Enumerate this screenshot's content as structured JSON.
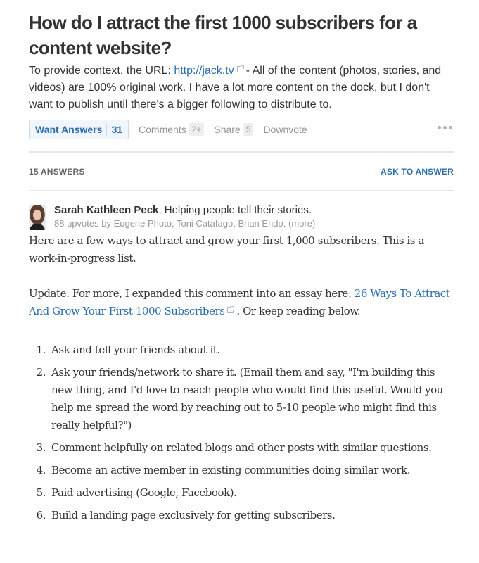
{
  "question": {
    "title": "How do I attract the first 1000 subscribers for a content website?",
    "details_before_link": "To provide context, the URL: ",
    "details_link": "http://jack.tv",
    "details_after_link": "- All of the content (photos, stories, and videos) are 100% original work. I have a lot more content on the dock, but I don't want to publish until there's a bigger following to distribute to."
  },
  "actions": {
    "want_answers_label": "Want Answers",
    "want_answers_count": "31",
    "comments_label": "Comments",
    "comments_count": "2+",
    "share_label": "Share",
    "share_count": "5",
    "downvote_label": "Downvote",
    "more_icon": "more-horizontal-icon"
  },
  "answers_header": {
    "count_label": "15 ANSWERS",
    "ask_to_answer_label": "ASK TO ANSWER"
  },
  "answer": {
    "author_name": "Sarah Kathleen Peck",
    "author_bio": ", Helping people tell their stories.",
    "upvotes_prefix": "88 upvotes by ",
    "voters": [
      "Eugene Photo",
      "Toni Catafago",
      "Brian Endo"
    ],
    "more_label": "(more)",
    "intro": "Here are a few ways to attract and grow your first 1,000 subscribers. This is a work-in-progress list.",
    "update_before_link": "Update: For more, I expanded this comment into an essay here: ",
    "update_link": "26 Ways To Attract And Grow Your First 1000 Subscribers",
    "update_after_link": ". Or keep reading below.",
    "list": [
      {
        "num": "1.",
        "text": "Ask and tell your friends about it."
      },
      {
        "num": "2.",
        "text": "Ask your friends/network to share it. (Email them and say, \"I'm building this new thing, and I'd love to reach people who would find this useful. Would you help me spread the word by reaching out to 5-10 people who might find this really helpful?\")"
      },
      {
        "num": "3.",
        "text": "Comment helpfully on related blogs and other posts with similar questions."
      },
      {
        "num": "4.",
        "text": "Become an active member in existing communities doing similar work."
      },
      {
        "num": "5.",
        "text": "Paid advertising (Google, Facebook)."
      },
      {
        "num": "6.",
        "text": "Build a landing page exclusively for getting subscribers."
      }
    ]
  },
  "colors": {
    "link": "#2b6dad",
    "text": "#333333",
    "muted": "#999999"
  }
}
